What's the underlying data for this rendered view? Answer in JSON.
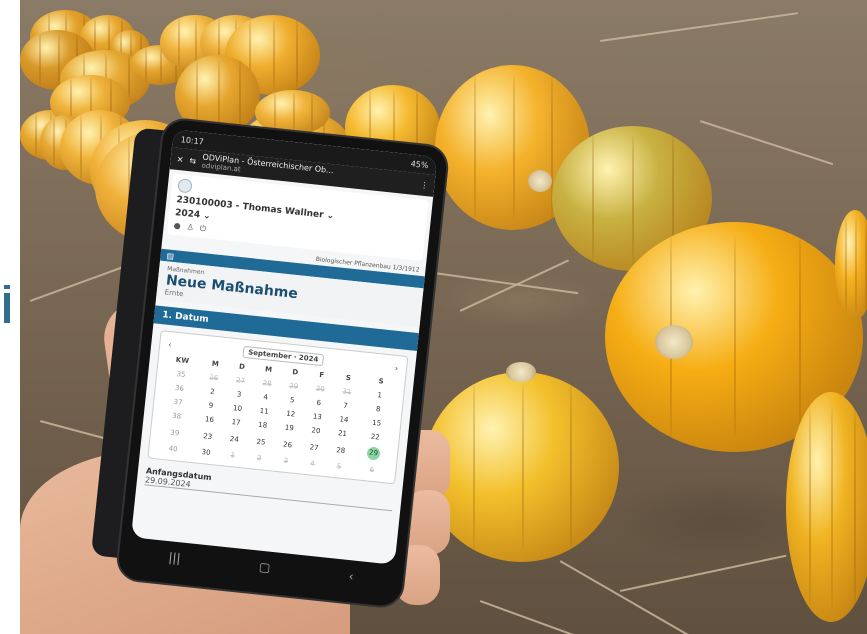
{
  "phone": {
    "status": {
      "time": "10:17",
      "battery": "45%"
    },
    "url_bar": {
      "title": "ODViPlan - Österreichischer Ob...",
      "domain": "odviplan.at",
      "close_icon": "close-icon"
    },
    "header": {
      "identity": "230100003 - Thomas Wallner",
      "year": "2024",
      "assignment": "Biologischer Pflanzenbau 1/3/1912"
    },
    "measure": {
      "crumb": "Maßnahmen",
      "title": "Neue Maßnahme",
      "subtitle": "Ernte"
    },
    "section_title": "1. Datum",
    "calendar": {
      "month": "September",
      "year": "2024",
      "headers": [
        "KW",
        "M",
        "D",
        "M",
        "D",
        "F",
        "S",
        "S"
      ],
      "rows": [
        [
          "35",
          "26",
          "27",
          "28",
          "29",
          "30",
          "31",
          "1"
        ],
        [
          "36",
          "2",
          "3",
          "4",
          "5",
          "6",
          "7",
          "8"
        ],
        [
          "37",
          "9",
          "10",
          "11",
          "12",
          "13",
          "14",
          "15"
        ],
        [
          "38",
          "16",
          "17",
          "18",
          "19",
          "20",
          "21",
          "22"
        ],
        [
          "39",
          "23",
          "24",
          "25",
          "26",
          "27",
          "28",
          "29"
        ],
        [
          "40",
          "30",
          "1",
          "2",
          "3",
          "4",
          "5",
          "6"
        ]
      ],
      "selected": "29"
    },
    "start_date": {
      "label": "Anfangsdatum",
      "value": "29.09.2024"
    }
  }
}
